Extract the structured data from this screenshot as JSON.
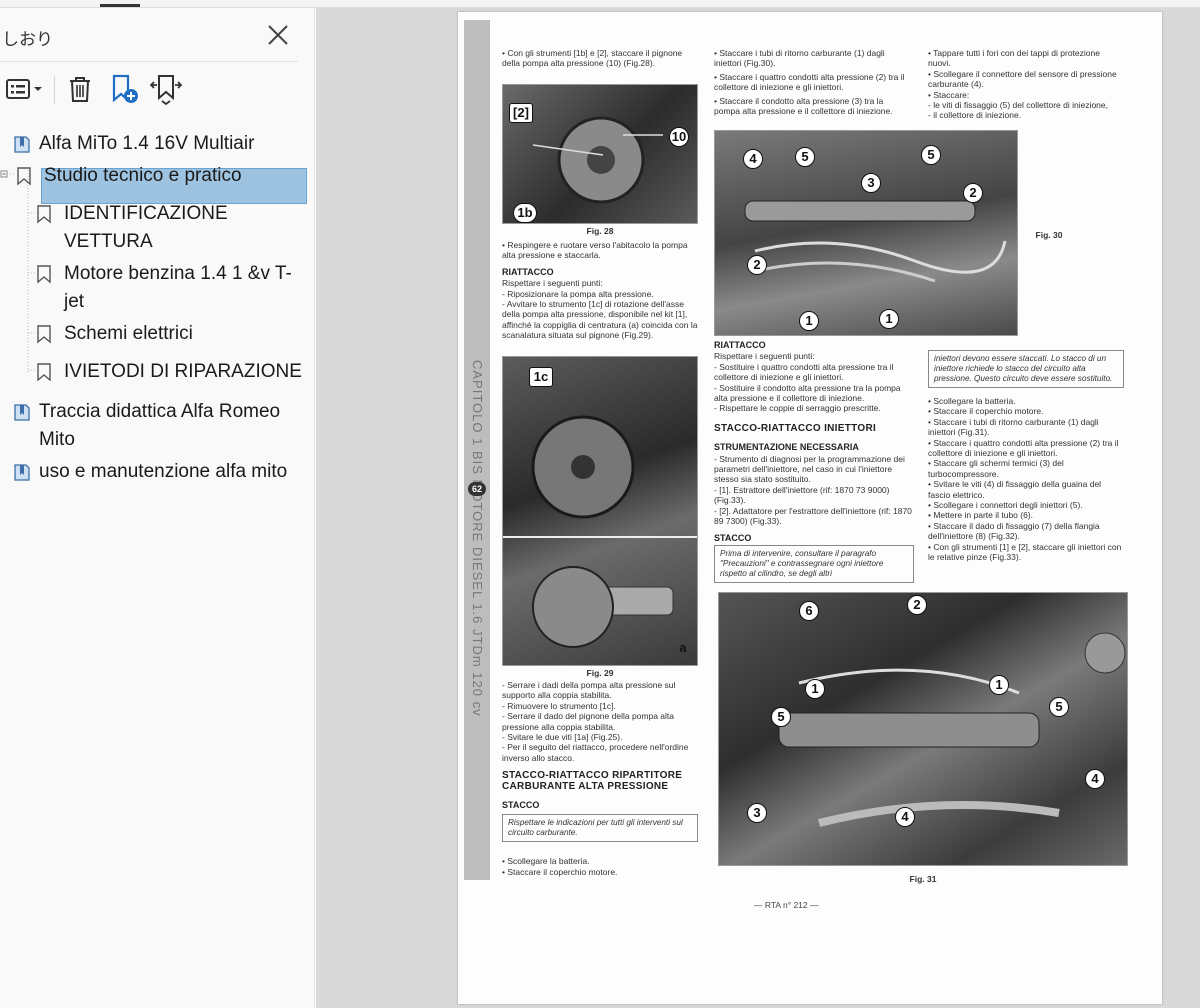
{
  "sidebar": {
    "title": "しおり",
    "items": [
      {
        "label": "Alfa MiTo 1.4 16V Multiair"
      },
      {
        "label": "Studio tecnico e pratico"
      },
      {
        "label": "IDENTIFICAZIONE VETTURA"
      },
      {
        "label": "Motore benzina 1.4 1 &v T-jet"
      },
      {
        "label": "Schemi elettrici"
      },
      {
        "label": "IVIETODI DI RIPARAZIONE"
      },
      {
        "label": "Traccia didattica Alfa Romeo Mito"
      },
      {
        "label": "uso e manutenzione alfa mito"
      }
    ]
  },
  "document": {
    "spine_text": "CAPITOLO 1 BIS  MOTORE DIESEL 1.6 JTDm 120 cv",
    "spine_badge": "62",
    "footer": "— RTA n° 212 —",
    "col1": {
      "p1": "• Con gli strumenti [1b] e [2], staccare il pignone della pompa alta pressione (10) (Fig.28).",
      "fig28": "Fig. 28",
      "p2": "• Respingere e ruotare verso l'abitacolo la pompa alta pressione e staccarla.",
      "h_riattacco": "RIATTACCO",
      "p3": "Rispettare i seguenti punti:",
      "p4": "- Riposizionare la pompa alta pressione.",
      "p5": "- Avvitare lo strumento [1c] di rotazione dell'asse della pompa alta pressione, disponibile nel kit [1], affinché la coppiglia di centratura (a) coincida con la scanalatura situata sul pignone (Fig.29).",
      "fig29": "Fig. 29",
      "p6": "- Serrare i dadi della pompa alta pressione sul supporto alla coppia stabilita.",
      "p7": "- Rimuovere lo strumento [1c].",
      "p8": "- Serrare il dado del pignone della pompa alta pressione alla coppia stabilita.",
      "p9": "- Svitare le due viti [1a] (Fig.25).",
      "p10": "- Per il seguito del riattacco, procedere nell'ordine inverso allo stacco.",
      "h_stacco_rip": "STACCO-RIATTACCO RIPARTITORE CARBURANTE ALTA PRESSIONE",
      "h_stacco": "STACCO",
      "note": "Rispettare le indicazioni per tutti gli interventi sul circuito carburante.",
      "p11": "• Scollegare la batteria.",
      "p12": "• Staccare il coperchio motore."
    },
    "col2": {
      "p1": "• Staccare i tubi di ritorno carburante (1) dagli iniettori (Fig.30).",
      "p2": "• Staccare i quattro condotti alta pressione (2) tra il collettore di iniezione e gli iniettori.",
      "p3": "• Staccare il condotto alta pressione (3) tra la pompa alta pressione e il collettore di iniezione.",
      "h_riattacco": "RIATTACCO",
      "p4": "Rispettare i seguenti punti:",
      "p5": "- Sostituire i quattro condotti alta pressione tra il collettore di iniezione e gli iniettori.",
      "p6": "- Sostituire il condotto alta pressione tra la pompa alta pressione e il collettore di iniezione.",
      "p7": "- Rispettare le coppie di serraggio prescritte.",
      "h_stacco_inj": "STACCO-RIATTACCO INIETTORI",
      "h_strum": "STRUMENTAZIONE NECESSARIA",
      "p8": "- Strumento di diagnosi per la programmazione dei parametri dell'iniettore, nel caso in cui l'iniettore stesso sia stato sostituito.",
      "p9": "- [1]. Estrattore dell'iniettore (rif: 1870 73 9000) (Fig.33).",
      "p10": "- [2]. Adattatore per l'estrattore dell'iniettore (rif: 1870 89 7300) (Fig.33).",
      "h_stacco": "STACCO",
      "note": "Prima di intervenire, consultare il paragrafo \"Precauzioni\" e contrassegnare ogni iniettore rispetto al cilindro, se degli altri",
      "fig31": "Fig. 31"
    },
    "col3": {
      "p1": "• Tappare tutti i fori con dei tappi di protezione nuovi.",
      "p2": "• Scollegare il connettore del sensore di pressione carburante (4).",
      "p3": "• Staccare:",
      "p4": "- le viti di fissaggio (5) del collettore di iniezione,",
      "p5": "- il collettore di iniezione.",
      "fig30": "Fig. 30",
      "note": "iniettori devono essere staccati. Lo stacco di un iniettore richiede lo stacco del circuito alta pressione. Questo circuito deve essere sostituito.",
      "p6": "• Scollegare la batteria.",
      "p7": "• Staccare il coperchio motore.",
      "p8": "• Staccare i tubi di ritorno carburante (1) dagli iniettori (Fig.31).",
      "p9": "• Staccare i quattro condotti alta pressione (2) tra il collettore di iniezione e gli iniettori.",
      "p10": "• Staccare gli schermi termici (3) del turbocompressore.",
      "p11": "• Svitare le viti (4) di fissaggio della guaina del fascio elettrico.",
      "p12": "• Scollegare i connettori degli iniettori (5).",
      "p13": "• Mettere in parte il tubo (6).",
      "p14": "• Staccare il dado di fissaggio (7) della flangia dell'iniettore (8) (Fig.32).",
      "p15": "• Con gli strumenti [1] e [2], staccare gli iniettori con le relative pinze (Fig.33)."
    },
    "callouts": {
      "fig28": [
        "[2]",
        "10",
        "1b"
      ],
      "fig29": [
        "1c",
        "a"
      ],
      "fig30": [
        "4",
        "5",
        "3",
        "5",
        "2",
        "2",
        "1",
        "1"
      ],
      "fig31": [
        "6",
        "2",
        "1",
        "1",
        "5",
        "5",
        "4",
        "3",
        "4"
      ]
    }
  }
}
